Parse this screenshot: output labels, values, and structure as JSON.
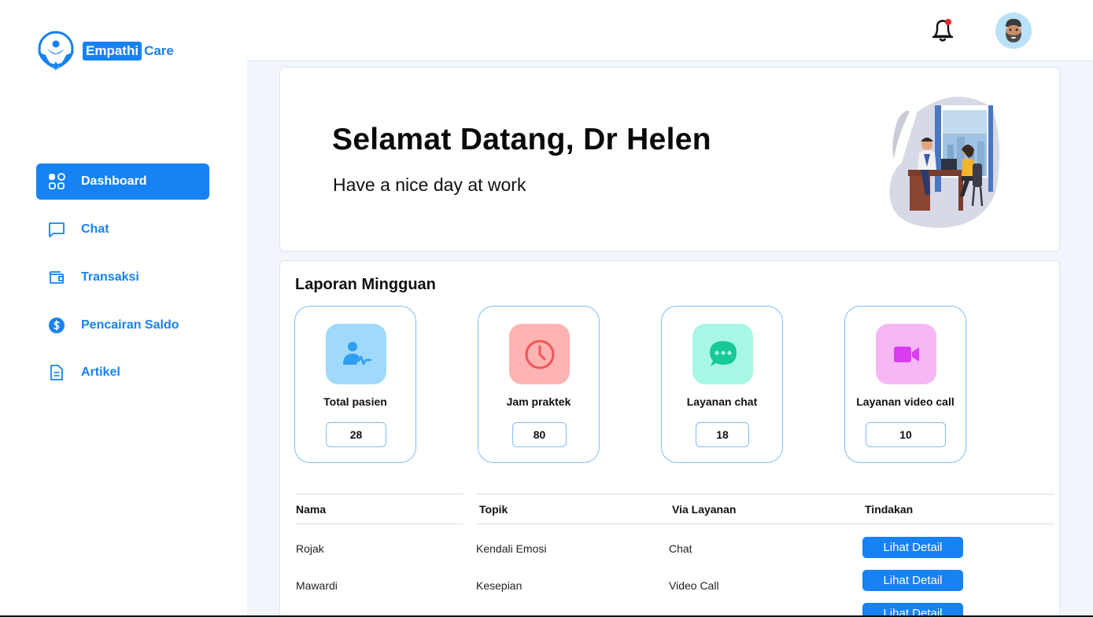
{
  "brand": {
    "name_part1": "Empathi",
    "name_part2": "Care"
  },
  "sidebar": {
    "items": [
      {
        "label": "Dashboard",
        "icon": "dashboard-grid-icon",
        "active": true
      },
      {
        "label": "Chat",
        "icon": "chat-bubble-icon",
        "active": false
      },
      {
        "label": "Transaksi",
        "icon": "wallet-icon",
        "active": false
      },
      {
        "label": "Pencairan Saldo",
        "icon": "dollar-circle-icon",
        "active": false
      },
      {
        "label": "Artikel",
        "icon": "document-icon",
        "active": false
      }
    ]
  },
  "header": {
    "notification_icon": "bell-icon",
    "has_notification": true,
    "avatar": "user-avatar"
  },
  "welcome": {
    "title": "Selamat Datang, Dr Helen",
    "subtitle": "Have a nice day at work"
  },
  "report": {
    "title": "Laporan Mingguan",
    "stats": [
      {
        "label": "Total pasien",
        "value": "28",
        "icon": "patient-icon",
        "bg": "#9fd9fb",
        "color": "#2f9df0"
      },
      {
        "label": "Jam praktek",
        "value": "80",
        "icon": "clock-icon",
        "bg": "#ffb3b3",
        "color": "#f25555"
      },
      {
        "label": "Layanan chat",
        "value": "18",
        "icon": "chat-dots-icon",
        "bg": "#a6f8e4",
        "color": "#16c997"
      },
      {
        "label": "Layanan video call",
        "value": "10",
        "icon": "video-camera-icon",
        "bg": "#f6b6f6",
        "color": "#d83df0"
      }
    ]
  },
  "table": {
    "columns": [
      "Nama",
      "Topik",
      "Via Layanan",
      "Tindakan"
    ],
    "rows": [
      {
        "nama": "Rojak",
        "topik": "Kendali Emosi",
        "via": "Chat",
        "action": "Lihat Detail"
      },
      {
        "nama": "Mawardi",
        "topik": "Kesepian",
        "via": "Video Call",
        "action": "Lihat Detail"
      },
      {
        "nama": "",
        "topik": "",
        "via": "",
        "action": "Lihat Detail"
      }
    ]
  }
}
